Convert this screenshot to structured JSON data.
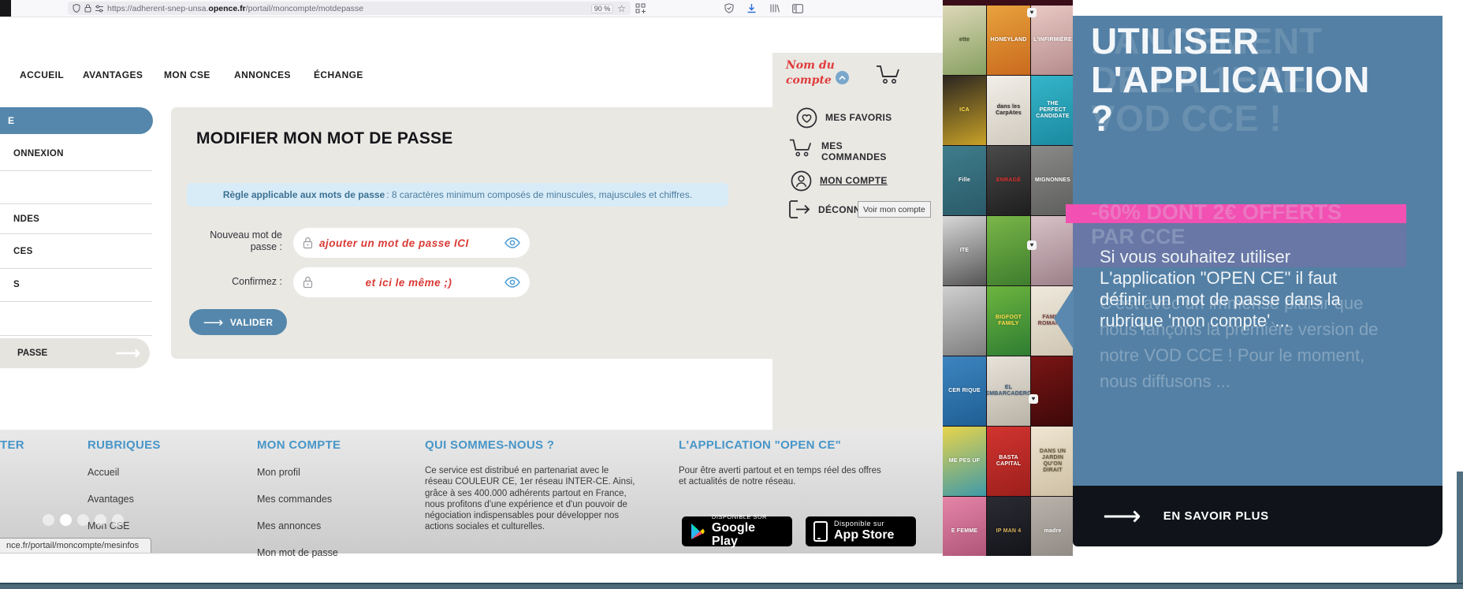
{
  "browser": {
    "url_prefix": "https://adherent-snep-unsa.",
    "url_domain": "opence.fr",
    "url_path": "/portail/moncompte/motdepasse",
    "zoom_level": "90 %",
    "star_glyph": "☆",
    "icons": [
      "shield-icon",
      "lock-icon",
      "tune-icon",
      "bookmark-star-icon",
      "extension-icon",
      "protections-icon",
      "download-icon",
      "library-icon",
      "sidebar-icon"
    ]
  },
  "nav": {
    "items": [
      "ACCUEIL",
      "AVANTAGES",
      "MON CSE",
      "ANNONCES",
      "ÉCHANGE"
    ]
  },
  "sidebar": {
    "active_fragment": "E",
    "items": [
      "ONNEXION",
      "NDES",
      "CES",
      "S"
    ],
    "password_fragment": "PASSE",
    "arrow": "⟶"
  },
  "form": {
    "title": "MODIFIER MON MOT DE PASSE",
    "rule_bold": "Règle applicable aux mots de passe",
    "rule_rest": " : 8 caractères minimum composés de minuscules, majuscules et chiffres.",
    "label_new": "Nouveau mot de\npasse :",
    "label_confirm": "Confirmez :",
    "annotation_new": "ajouter un mot de passe ICI",
    "annotation_confirm": "et ici le même ;)",
    "submit_label": "VALIDER",
    "submit_arrow": "⟶"
  },
  "account": {
    "name": "Nom du\ncompte",
    "items": [
      "MES FAVORIS",
      "MES\nCOMMANDES",
      "MON COMPTE",
      "DÉCONN"
    ],
    "tooltip": "Voir mon compte",
    "heart_glyph": "♥"
  },
  "posters": {
    "tiles": [
      {
        "t": "ette",
        "c1": "#ddd8b8",
        "c2": "#86a060",
        "tc": "#4b5a2e"
      },
      {
        "t": "HONEYLAND",
        "c1": "#e8a23c",
        "c2": "#c96a1e",
        "tc": "#ffffff"
      },
      {
        "t": "L'INFIRMIÈRE",
        "c1": "#e9c9c4",
        "c2": "#b58b8c",
        "tc": "#ffffff"
      },
      {
        "t": "ICA",
        "c1": "#2a2520",
        "c2": "#c9a227",
        "tc": "#ffe14d"
      },
      {
        "t": "dans les CarpAtes",
        "c1": "#f2efe9",
        "c2": "#cfc9bd",
        "tc": "#33312c"
      },
      {
        "t": "THE PERFECT CANDIDATE",
        "c1": "#35b5c9",
        "c2": "#1a8aa0",
        "tc": "#ffffff"
      },
      {
        "t": "Fille",
        "c1": "#3f7d8c",
        "c2": "#2a5a68",
        "tc": "#ffffff"
      },
      {
        "t": "ENRAGÉ",
        "c1": "#4a4a4a",
        "c2": "#1e1e1e",
        "tc": "#e03232"
      },
      {
        "t": "MIGNONNES",
        "c1": "#8a8a88",
        "c2": "#5e5e5c",
        "tc": "#ffffff"
      },
      {
        "t": "ITE",
        "c1": "#d8d8d8",
        "c2": "#555555",
        "tc": "#ffffff"
      },
      {
        "t": "",
        "c1": "#7ab648",
        "c2": "#3e7d2e",
        "tc": "#ffffff"
      },
      {
        "t": "",
        "c1": "#d8c2c8",
        "c2": "#9c7f88",
        "tc": "#ffffff"
      },
      {
        "t": "",
        "c1": "#cfcfcf",
        "c2": "#7e7e7e",
        "tc": "#ffffff"
      },
      {
        "t": "BIGFOOT FAMILY",
        "c1": "#6db53f",
        "c2": "#2e7d32",
        "tc": "#ffe14d"
      },
      {
        "t": "FAMILY ROMANCE",
        "c1": "#efe9dd",
        "c2": "#cfc5b2",
        "tc": "#7a4040"
      },
      {
        "t": "CER RIQUE",
        "c1": "#3d85c0",
        "c2": "#1f5f94",
        "tc": "#ffffff"
      },
      {
        "t": "EL EMBARCADERO",
        "c1": "#e8e3da",
        "c2": "#b9b3a6",
        "tc": "#3a5a7a"
      },
      {
        "t": "",
        "c1": "#7a1515",
        "c2": "#3d0808",
        "tc": "#ffffff"
      },
      {
        "t": "ME PES UF",
        "c1": "#e8d44a",
        "c2": "#3f9aa8",
        "tc": "#ffffff"
      },
      {
        "t": "BASTA CAPITAL",
        "c1": "#d23430",
        "c2": "#9c1f1c",
        "tc": "#ffffff"
      },
      {
        "t": "DANS UN JARDIN QU'ON DIRAIT",
        "c1": "#efe6d2",
        "c2": "#cdbfa4",
        "tc": "#6a5a3a"
      },
      {
        "t": "E FEMME",
        "c1": "#e585a8",
        "c2": "#a84f72",
        "tc": "#ffffff"
      },
      {
        "t": "IP MAN 4",
        "c1": "#2b2b33",
        "c2": "#101016",
        "tc": "#d8b45a"
      },
      {
        "t": "madre",
        "c1": "#b9b3ac",
        "c2": "#8a857e",
        "tc": "#ffffff"
      }
    ]
  },
  "overlay": {
    "title": "UTILISER\nL'APPLICATION\n?",
    "title_ghost": "LANCEMENT\nDE LA 1ERE\nVOD CCE !",
    "subtitle_ghost": "-60% DONT 2€ OFFERTS\nPAR CCE",
    "paragraph": "Si vous souhaitez utiliser\nL'application \"OPEN CE\" il faut\ndéfinir un mot de passe dans la\nrubrique 'mon compte' ...",
    "paragraph_ghost": "C'est avec un immense plaisir que\nnous lançons la première version de\nnotre VOD CCE ! Pour le moment,\nnous diffusons ...",
    "cta": "EN SAVOIR PLUS",
    "cta_arrow": "⟶"
  },
  "footer": {
    "contact_fragment": "TER",
    "carousel": {
      "count": 5,
      "active": 1
    },
    "rubriques": {
      "heading": "RUBRIQUES",
      "links": [
        "Accueil",
        "Avantages",
        "Mon CSE"
      ]
    },
    "moncompte": {
      "heading": "MON COMPTE",
      "links": [
        "Mon profil",
        "Mes commandes",
        "Mes annonces",
        "Mon mot de passe"
      ]
    },
    "quisommesnous": {
      "heading": "QUI SOMMES-NOUS ?",
      "text": "Ce service est distribué en partenariat avec le\nréseau COULEUR CE, 1er réseau INTER-CE. Ainsi,\ngrâce à ses 400.000 adhérents partout en France,\nnous profitons d'une expérience et d'un pouvoir de\nnégociation indispensables pour développer nos\nactions sociales et culturelles."
    },
    "application": {
      "heading": "L'APPLICATION \"OPEN CE\"",
      "text": "Pour être averti partout et en temps réel des offres\net actualités de notre réseau.",
      "googleplay": {
        "small": "DISPONIBLE SUR",
        "big": "Google Play"
      },
      "appstore": {
        "small": "Disponible sur",
        "big": "App Store"
      }
    }
  },
  "status_bar": {
    "url": "nce.fr/portail/moncompte/mesinfos"
  },
  "colors": {
    "accent_blue": "#5587ac",
    "panel_beige": "#e9e8e3",
    "info_bg": "#d8ecf8",
    "info_text": "#3c7193",
    "annotation_red": "#d93a35",
    "overlay_blue": "#5480a5",
    "pink": "#f250b2",
    "dark_cta": "#10141a",
    "footer_heading_blue": "#4796c8",
    "bottom_bar": "#4d6b7a"
  }
}
